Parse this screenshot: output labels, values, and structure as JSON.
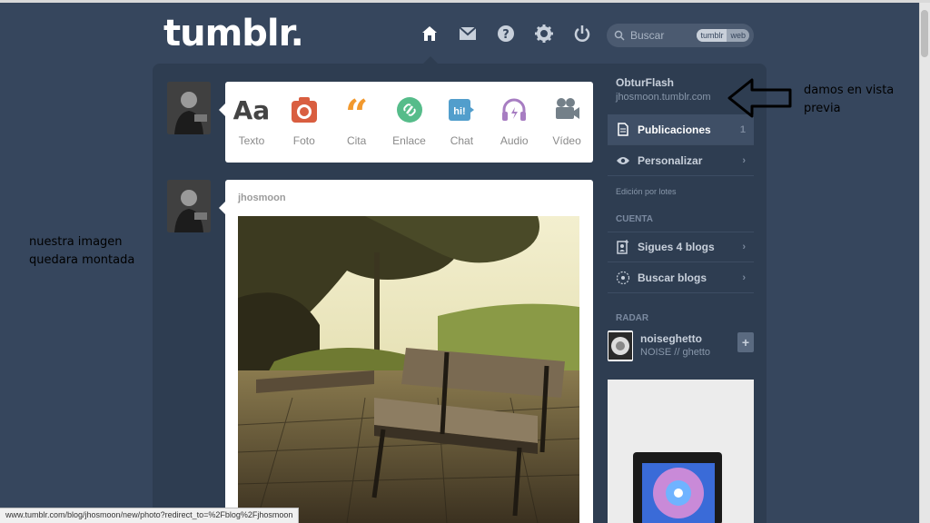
{
  "header": {
    "logo": "tumblr.",
    "nav_icons": [
      "home-icon",
      "mail-icon",
      "help-icon",
      "gear-icon",
      "power-icon"
    ],
    "search": {
      "placeholder": "Buscar",
      "scope_options": [
        "tumblr",
        "web"
      ],
      "scope_selected": "tumblr"
    }
  },
  "post_types": [
    {
      "label": "Texto",
      "icon": "text-icon",
      "color": "#444444"
    },
    {
      "label": "Foto",
      "icon": "camera-icon",
      "color": "#d95e40"
    },
    {
      "label": "Cita",
      "icon": "quote-icon",
      "color": "#f2992e"
    },
    {
      "label": "Enlace",
      "icon": "link-icon",
      "color": "#56bc8a"
    },
    {
      "label": "Chat",
      "icon": "chat-icon",
      "color": "#529ecc"
    },
    {
      "label": "Audio",
      "icon": "headphones-icon",
      "color": "#a77dc2"
    },
    {
      "label": "Vídeo",
      "icon": "video-camera-icon",
      "color": "#748089"
    }
  ],
  "post": {
    "author": "jhosmoon"
  },
  "sidebar": {
    "blog_name": "ObturFlash",
    "blog_url": "jhosmoon.tumblr.com",
    "publicaciones": {
      "label": "Publicaciones",
      "count": "1"
    },
    "personalizar": {
      "label": "Personalizar"
    },
    "edicion": "Edición por lotes",
    "cuenta_heading": "CUENTA",
    "sigues": {
      "label": "Sigues 4 blogs"
    },
    "buscar": {
      "label": "Buscar blogs"
    },
    "radar_heading": "RADAR",
    "radar_blog": {
      "name": "noiseghetto",
      "sub": "NOISE // ghetto",
      "add": "+"
    }
  },
  "annotations": {
    "left_line1": "nuestra imagen",
    "left_line2": "quedara montada",
    "right_line1": "damos en vista",
    "right_line2": "previa"
  },
  "status_url": "www.tumblr.com/blog/jhosmoon/new/photo?redirect_to=%2Fblog%2Fjhosmoon",
  "colors": {
    "background": "#36465d",
    "dashboard": "#2e3d51",
    "accent": "#529ecc"
  }
}
